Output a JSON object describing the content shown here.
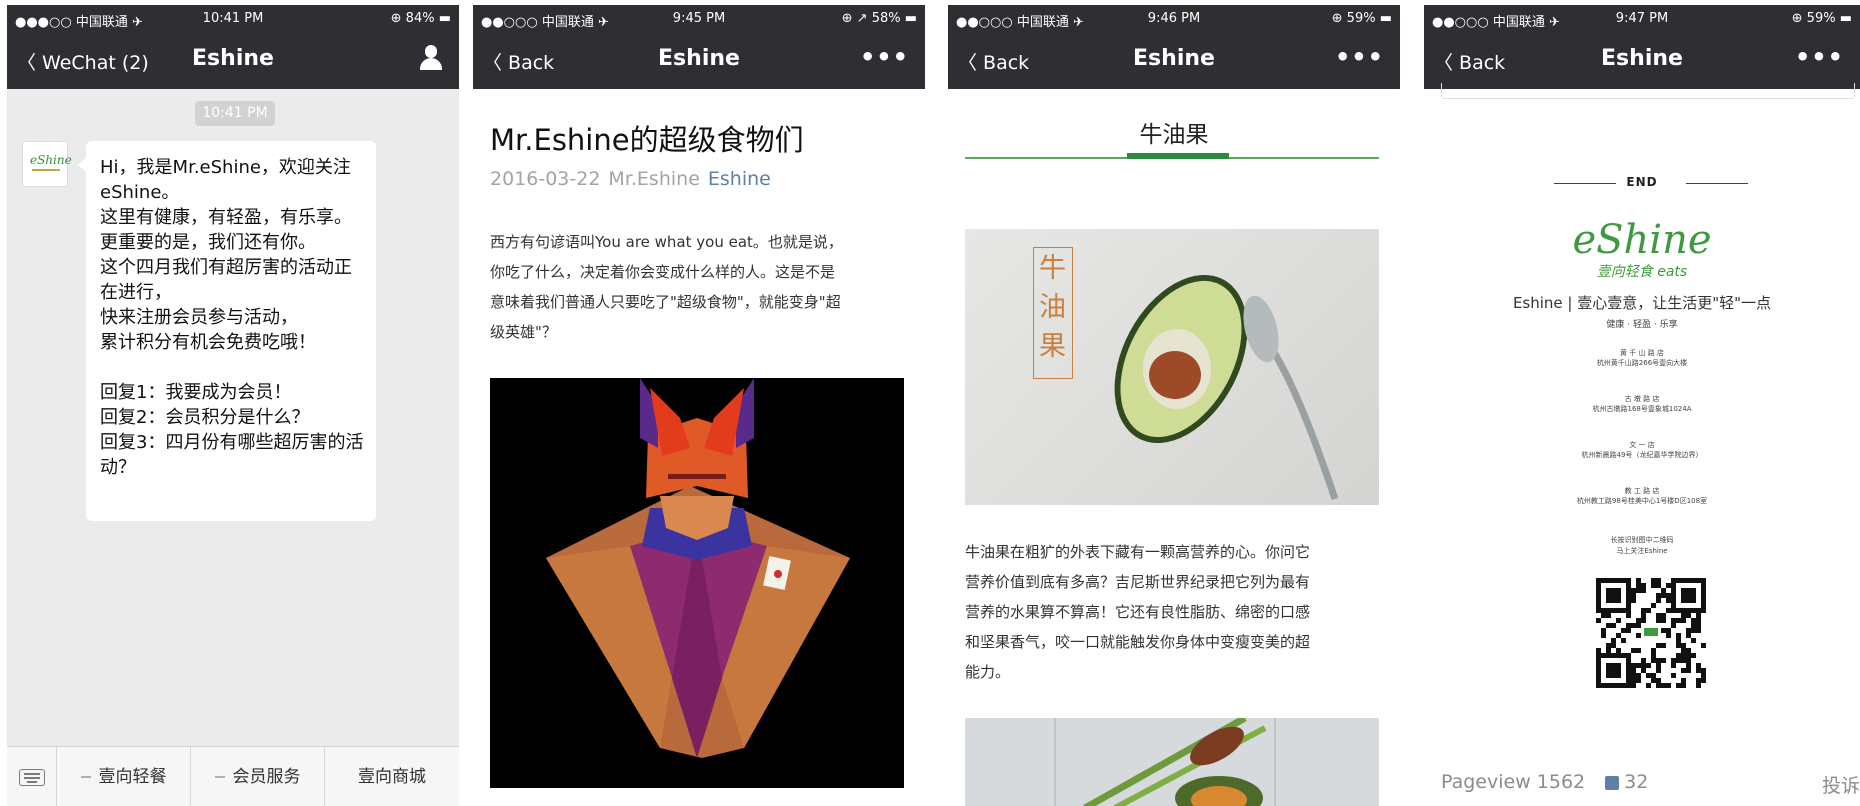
{
  "panels": [
    {
      "status": {
        "carrier": "●●●○○ 中国联通 ✈",
        "time": "10:41 PM",
        "battery": "⊕ 84% ▬"
      },
      "nav": {
        "back": "〈 WeChat (2)",
        "title": "Eshine"
      },
      "chat": {
        "time_badge": "10:41 PM",
        "avatar_text": "eShine",
        "message": "Hi，我是Mr.eShine，欢迎关注eShine。\n这里有健康，有轻盈，有乐享。\n更重要的是，我们还有你。\n这个四月我们有超厉害的活动正在进行，\n快来注册会员参与活动，\n累计积分有机会免费吃哦！\n\n回复1：我要成为会员！\n回复2：会员积分是什么？\n回复3：四月份有哪些超厉害的活动？"
      },
      "menu": [
        "壹向轻餐",
        "会员服务",
        "壹向商城"
      ]
    },
    {
      "status": {
        "carrier": "●●○○○ 中国联通 ✈",
        "time": "9:45 PM",
        "battery": "⊕ ↗ 58% ▬"
      },
      "nav": {
        "back": "〈 Back",
        "title": "Eshine",
        "more": "•••"
      },
      "article": {
        "title": "Mr.Eshine的超级食物们",
        "date": "2016-03-22",
        "author": "Mr.Eshine",
        "account": "Eshine",
        "body": "西方有句谚语叫You are what you eat。也就是说，\n你吃了什么，决定着你会变成什么样的人。这是不是\n意味着我们普通人只要吃了\"超级食物\"，就能变身\"超\n级英雄\"？"
      }
    },
    {
      "status": {
        "carrier": "●●○○○ 中国联通 ✈",
        "time": "9:46 PM",
        "battery": "⊕ 59% ▬"
      },
      "nav": {
        "back": "〈 Back",
        "title": "Eshine",
        "more": "•••"
      },
      "section": {
        "title": "牛油果",
        "image_caption": "牛\n油\n果",
        "body": "牛油果在粗犷的外表下藏有一颗高营养的心。你问它\n营养价值到底有多高？吉尼斯世界纪录把它列为最有\n营养的水果算不算高！它还有良性脂肪、绵密的口感\n和坚果香气，咬一口就能触发你身体中变瘦变美的超\n能力。"
      }
    },
    {
      "status": {
        "carrier": "●●○○○ 中国联通 ✈",
        "time": "9:47 PM",
        "battery": "⊕ 59% ▬"
      },
      "nav": {
        "back": "〈 Back",
        "title": "Eshine",
        "more": "•••"
      },
      "footer_card": {
        "end": "END",
        "logo": "eShine",
        "logo_sub": "壹向轻食 eats",
        "tagline": "Eshine | 壹心壹意，让生活更\"轻\"一点",
        "values": "健康 · 轻盈 · 乐享",
        "stores": [
          "黄 千 山 路 店",
          "杭州黄千山路266号壹向大楼",
          "古 墩 路 店",
          "杭州古墩路168号壹象城1024A",
          "文 一 店",
          "杭州新晨路49号（龙纪嘉华学院边界）",
          "教 工 路 店",
          "杭州教工路98号桂美中心1号楼D区108室"
        ],
        "qr_caption": "长按识别图中二维码\n马上关注Eshine"
      },
      "stats": {
        "pageview": "Pageview 1562",
        "likes": "32",
        "report": "投诉"
      }
    }
  ],
  "colors": {
    "nav": "#2e2e33",
    "link": "#607fa6",
    "green": "#3f9a3f",
    "chat_bg": "#ebebeb"
  }
}
